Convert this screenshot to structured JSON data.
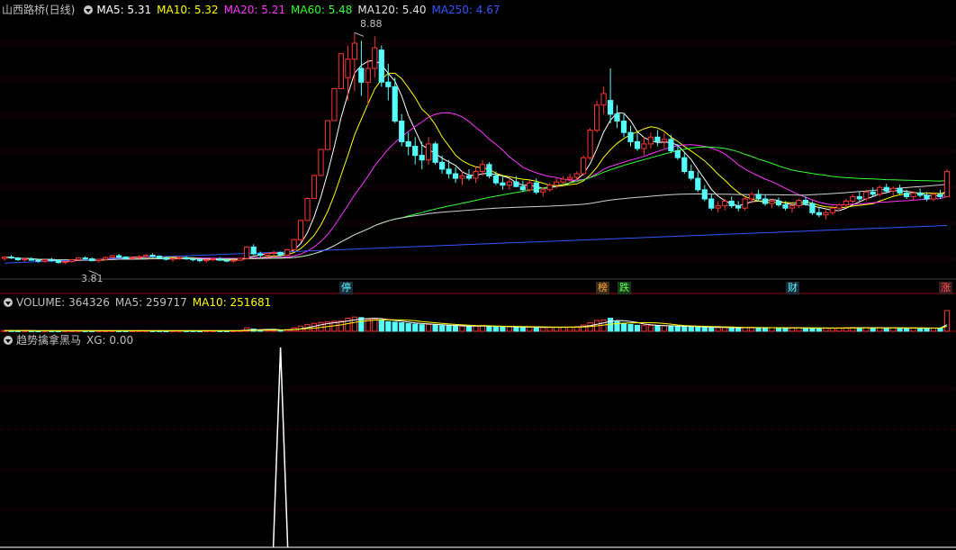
{
  "main_panel": {
    "title": "山西路桥(日线)",
    "ma": [
      {
        "label": "MA5: 5.31",
        "color": "#ffffff"
      },
      {
        "label": "MA10: 5.32",
        "color": "#ffff00"
      },
      {
        "label": "MA20: 5.21",
        "color": "#ff33ff"
      },
      {
        "label": "MA60: 5.48",
        "color": "#33ff33"
      },
      {
        "label": "MA120: 5.40",
        "color": "#e0e0e0"
      },
      {
        "label": "MA250: 4.67",
        "color": "#3355ff"
      }
    ],
    "high_label": "8.88",
    "low_label": "3.81",
    "markers": [
      {
        "text": "停",
        "color": "#55ffff",
        "bg": "#1a2a3a"
      },
      {
        "text": "榜",
        "color": "#ffaa33",
        "bg": "#3a2a1a"
      },
      {
        "text": "跌",
        "color": "#55ff55",
        "bg": "#1a3a1a"
      },
      {
        "text": "财",
        "color": "#55ffff",
        "bg": "#1a2a3a"
      },
      {
        "text": "涨",
        "color": "#ff5555",
        "bg": "#3a1a1a"
      }
    ]
  },
  "volume_panel": {
    "title": "VOLUME: 364326",
    "ma5": "MA5: 259717",
    "ma10": "MA10: 251681"
  },
  "indicator_panel": {
    "title": "趋势擒拿黑马",
    "xg": "XG: 0.00"
  },
  "colors": {
    "up": "#ff3333",
    "down": "#54fcfc",
    "grid": "#7a0000",
    "sep": "#9a0000",
    "text": "#c0c0c0"
  },
  "chart_data": {
    "type": "candlestick",
    "price_range": [
      3.5,
      9.2
    ],
    "candles": [
      [
        3.95,
        4.0,
        3.9,
        3.98
      ],
      [
        3.98,
        4.02,
        3.94,
        3.96
      ],
      [
        3.96,
        3.98,
        3.9,
        3.92
      ],
      [
        3.92,
        3.96,
        3.88,
        3.94
      ],
      [
        3.94,
        3.98,
        3.9,
        3.91
      ],
      [
        3.91,
        3.94,
        3.86,
        3.89
      ],
      [
        3.89,
        3.93,
        3.85,
        3.92
      ],
      [
        3.92,
        3.96,
        3.88,
        3.9
      ],
      [
        3.9,
        3.93,
        3.84,
        3.86
      ],
      [
        3.86,
        3.9,
        3.82,
        3.88
      ],
      [
        3.88,
        3.94,
        3.86,
        3.92
      ],
      [
        3.92,
        3.98,
        3.9,
        3.96
      ],
      [
        3.96,
        4.0,
        3.92,
        3.94
      ],
      [
        3.94,
        3.97,
        3.89,
        3.9
      ],
      [
        3.9,
        3.94,
        3.86,
        3.93
      ],
      [
        3.93,
        3.99,
        3.91,
        3.97
      ],
      [
        3.97,
        4.03,
        3.95,
        4.01
      ],
      [
        4.01,
        4.05,
        3.96,
        3.98
      ],
      [
        3.98,
        4.0,
        3.93,
        3.95
      ],
      [
        3.95,
        3.99,
        3.91,
        3.97
      ],
      [
        3.97,
        4.02,
        3.94,
        3.99
      ],
      [
        3.99,
        4.04,
        3.96,
        4.02
      ],
      [
        4.02,
        4.06,
        3.98,
        4.0
      ],
      [
        4.0,
        4.02,
        3.94,
        3.96
      ],
      [
        3.96,
        3.99,
        3.91,
        3.93
      ],
      [
        3.93,
        3.96,
        3.88,
        3.95
      ],
      [
        3.95,
        3.99,
        3.92,
        3.97
      ],
      [
        3.97,
        4.0,
        3.92,
        3.94
      ],
      [
        3.94,
        3.97,
        3.89,
        3.92
      ],
      [
        3.92,
        3.95,
        3.87,
        3.9
      ],
      [
        3.9,
        3.94,
        3.86,
        3.92
      ],
      [
        3.92,
        3.96,
        3.89,
        3.94
      ],
      [
        3.94,
        3.98,
        3.9,
        3.91
      ],
      [
        3.91,
        3.94,
        3.87,
        3.89
      ],
      [
        3.89,
        3.92,
        3.85,
        3.91
      ],
      [
        3.91,
        3.97,
        3.89,
        3.95
      ],
      [
        3.95,
        4.22,
        3.93,
        4.2
      ],
      [
        4.2,
        4.26,
        4.02,
        4.05
      ],
      [
        4.05,
        4.1,
        3.98,
        4.02
      ],
      [
        4.02,
        4.08,
        3.97,
        4.06
      ],
      [
        4.06,
        4.12,
        4.0,
        4.08
      ],
      [
        4.08,
        4.1,
        3.99,
        4.02
      ],
      [
        4.02,
        4.16,
        4.0,
        4.14
      ],
      [
        4.14,
        4.38,
        4.12,
        4.36
      ],
      [
        4.36,
        4.8,
        4.3,
        4.78
      ],
      [
        4.78,
        5.28,
        4.78,
        5.26
      ],
      [
        5.26,
        5.78,
        5.26,
        5.76
      ],
      [
        5.76,
        6.34,
        5.76,
        6.33
      ],
      [
        6.33,
        6.96,
        6.33,
        6.96
      ],
      [
        6.96,
        7.66,
        6.96,
        7.66
      ],
      [
        7.66,
        8.42,
        7.66,
        8.42
      ],
      [
        7.9,
        8.6,
        7.4,
        8.3
      ],
      [
        8.3,
        8.88,
        7.6,
        8.65
      ],
      [
        8.1,
        8.7,
        7.5,
        7.8
      ],
      [
        7.8,
        8.3,
        7.3,
        8.1
      ],
      [
        8.1,
        8.8,
        7.9,
        8.55
      ],
      [
        8.5,
        8.6,
        7.7,
        7.8
      ],
      [
        7.8,
        8.2,
        7.4,
        7.7
      ],
      [
        7.7,
        7.9,
        6.9,
        6.95
      ],
      [
        6.95,
        7.1,
        6.4,
        6.5
      ],
      [
        6.5,
        6.7,
        6.2,
        6.4
      ],
      [
        6.4,
        6.6,
        6.0,
        6.2
      ],
      [
        6.2,
        6.5,
        5.9,
        6.1
      ],
      [
        6.1,
        6.6,
        6.0,
        6.45
      ],
      [
        6.45,
        6.5,
        6.0,
        6.05
      ],
      [
        6.05,
        6.2,
        5.8,
        5.9
      ],
      [
        5.9,
        6.1,
        5.7,
        5.8
      ],
      [
        5.8,
        5.95,
        5.6,
        5.7
      ],
      [
        5.7,
        5.85,
        5.55,
        5.75
      ],
      [
        5.75,
        5.9,
        5.65,
        5.7
      ],
      [
        5.7,
        5.95,
        5.6,
        5.85
      ],
      [
        5.85,
        6.1,
        5.75,
        6.0
      ],
      [
        6.0,
        6.05,
        5.7,
        5.75
      ],
      [
        5.75,
        5.85,
        5.55,
        5.6
      ],
      [
        5.6,
        5.75,
        5.45,
        5.55
      ],
      [
        5.55,
        5.7,
        5.45,
        5.62
      ],
      [
        5.62,
        5.75,
        5.5,
        5.52
      ],
      [
        5.52,
        5.65,
        5.4,
        5.45
      ],
      [
        5.45,
        5.65,
        5.4,
        5.6
      ],
      [
        5.6,
        5.7,
        5.35,
        5.4
      ],
      [
        5.4,
        5.5,
        5.3,
        5.45
      ],
      [
        5.45,
        5.6,
        5.4,
        5.55
      ],
      [
        5.55,
        5.7,
        5.48,
        5.62
      ],
      [
        5.62,
        5.75,
        5.55,
        5.68
      ],
      [
        5.68,
        5.8,
        5.6,
        5.72
      ],
      [
        5.72,
        5.85,
        5.65,
        5.8
      ],
      [
        5.8,
        6.2,
        5.75,
        6.15
      ],
      [
        6.15,
        6.8,
        6.1,
        6.75
      ],
      [
        6.75,
        7.4,
        6.7,
        7.3
      ],
      [
        7.3,
        7.7,
        7.1,
        7.55
      ],
      [
        7.4,
        8.1,
        6.9,
        7.1
      ],
      [
        7.1,
        7.3,
        6.8,
        6.95
      ],
      [
        6.95,
        7.1,
        6.6,
        6.7
      ],
      [
        6.7,
        6.85,
        6.4,
        6.5
      ],
      [
        6.5,
        6.7,
        6.3,
        6.35
      ],
      [
        6.35,
        6.6,
        6.2,
        6.45
      ],
      [
        6.45,
        6.7,
        6.35,
        6.6
      ],
      [
        6.6,
        6.75,
        6.4,
        6.5
      ],
      [
        6.5,
        6.7,
        6.35,
        6.55
      ],
      [
        6.55,
        6.65,
        6.25,
        6.3
      ],
      [
        6.3,
        6.45,
        6.1,
        6.15
      ],
      [
        6.15,
        6.25,
        5.8,
        5.85
      ],
      [
        5.85,
        6.0,
        5.65,
        5.7
      ],
      [
        5.7,
        5.85,
        5.4,
        5.45
      ],
      [
        5.45,
        5.55,
        5.2,
        5.25
      ],
      [
        5.25,
        5.35,
        5.0,
        5.05
      ],
      [
        5.05,
        5.2,
        4.95,
        5.1
      ],
      [
        5.1,
        5.25,
        5.0,
        5.2
      ],
      [
        5.2,
        5.3,
        5.05,
        5.1
      ],
      [
        5.1,
        5.2,
        4.98,
        5.05
      ],
      [
        5.05,
        5.3,
        5.0,
        5.25
      ],
      [
        5.25,
        5.4,
        5.15,
        5.35
      ],
      [
        5.35,
        5.45,
        5.2,
        5.25
      ],
      [
        5.25,
        5.35,
        5.1,
        5.15
      ],
      [
        5.15,
        5.25,
        5.05,
        5.2
      ],
      [
        5.2,
        5.28,
        5.08,
        5.12
      ],
      [
        5.12,
        5.2,
        5.0,
        5.05
      ],
      [
        5.05,
        5.15,
        4.95,
        5.1
      ],
      [
        5.1,
        5.25,
        5.05,
        5.22
      ],
      [
        5.22,
        5.3,
        5.1,
        5.15
      ],
      [
        5.15,
        5.2,
        4.9,
        4.95
      ],
      [
        4.95,
        5.05,
        4.85,
        4.9
      ],
      [
        4.9,
        5.0,
        4.8,
        4.95
      ],
      [
        4.95,
        5.1,
        4.9,
        5.05
      ],
      [
        5.05,
        5.15,
        4.98,
        5.12
      ],
      [
        5.12,
        5.25,
        5.05,
        5.2
      ],
      [
        5.2,
        5.35,
        5.15,
        5.3
      ],
      [
        5.3,
        5.4,
        5.2,
        5.25
      ],
      [
        5.25,
        5.45,
        5.2,
        5.4
      ],
      [
        5.4,
        5.5,
        5.3,
        5.35
      ],
      [
        5.35,
        5.55,
        5.3,
        5.5
      ],
      [
        5.5,
        5.58,
        5.38,
        5.42
      ],
      [
        5.42,
        5.52,
        5.32,
        5.48
      ],
      [
        5.48,
        5.56,
        5.35,
        5.38
      ],
      [
        5.38,
        5.45,
        5.25,
        5.3
      ],
      [
        5.3,
        5.42,
        5.22,
        5.38
      ],
      [
        5.38,
        5.48,
        5.28,
        5.33
      ],
      [
        5.33,
        5.4,
        5.2,
        5.25
      ],
      [
        5.25,
        5.4,
        5.2,
        5.35
      ],
      [
        5.35,
        5.45,
        5.25,
        5.3
      ],
      [
        5.3,
        5.9,
        5.28,
        5.85
      ]
    ],
    "volume": [
      12000,
      11000,
      9800,
      10500,
      9000,
      8700,
      9300,
      8900,
      8200,
      9100,
      10200,
      11000,
      9400,
      8800,
      9200,
      10100,
      11200,
      9900,
      9100,
      9600,
      10400,
      11100,
      9800,
      9000,
      8600,
      9200,
      9700,
      9100,
      8800,
      8400,
      9000,
      9400,
      9000,
      8600,
      8900,
      12000,
      60000,
      38000,
      24000,
      22000,
      21000,
      19000,
      30000,
      58000,
      90000,
      120000,
      140000,
      155000,
      165000,
      175000,
      180000,
      230000,
      250000,
      240000,
      210000,
      220000,
      190000,
      170000,
      160000,
      150000,
      135000,
      125000,
      115000,
      120000,
      110000,
      100000,
      95000,
      90000,
      88000,
      85000,
      92000,
      98000,
      87000,
      80000,
      76000,
      78000,
      74000,
      70000,
      72000,
      68000,
      66000,
      70000,
      73000,
      75000,
      76000,
      80000,
      110000,
      150000,
      190000,
      200000,
      230000,
      170000,
      140000,
      120000,
      105000,
      100000,
      102000,
      95000,
      97000,
      90000,
      85000,
      82000,
      78000,
      74000,
      70000,
      66000,
      64000,
      66000,
      62000,
      60000,
      64000,
      68000,
      63000,
      60000,
      62000,
      58000,
      56000,
      58000,
      61000,
      59000,
      55000,
      53000,
      55000,
      58000,
      60000,
      63000,
      66000,
      62000,
      64000,
      60000,
      63000,
      58000,
      60000,
      57000,
      54000,
      58000,
      55000,
      52000,
      56000,
      54000,
      364326
    ],
    "signal": {
      "index": 41,
      "peak": 1.0
    }
  }
}
